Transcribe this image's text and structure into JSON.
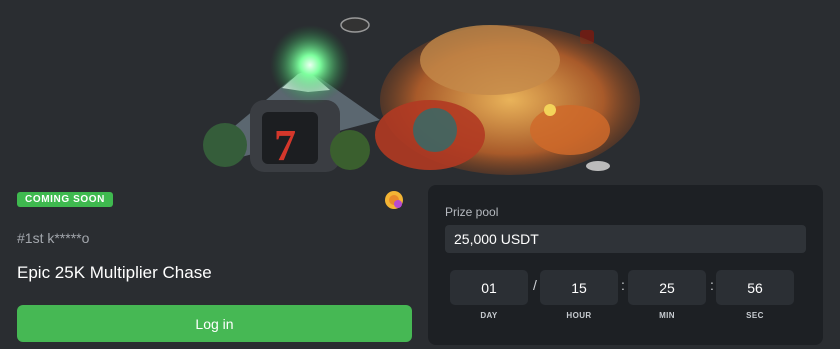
{
  "event": {
    "status_badge": "COMING SOON",
    "rank_text": "#1st k*****o",
    "title": "Epic 25K Multiplier Chase",
    "login_label": "Log in"
  },
  "prize": {
    "label": "Prize pool",
    "value": "25,000 USDT"
  },
  "countdown": {
    "day": "01",
    "hour": "15",
    "min": "25",
    "sec": "56",
    "sep_day": "/",
    "sep_time": ":",
    "labels": {
      "day": "DAY",
      "hour": "HOUR",
      "min": "MIN",
      "sec": "SEC"
    }
  },
  "colors": {
    "background": "#2a2d31",
    "panel": "#1d2024",
    "accent_green": "#46b854",
    "badge_green": "#3fb94f"
  },
  "icons": {
    "hero": "dragon-slot-banner",
    "coin": "coin-stack-icon"
  }
}
